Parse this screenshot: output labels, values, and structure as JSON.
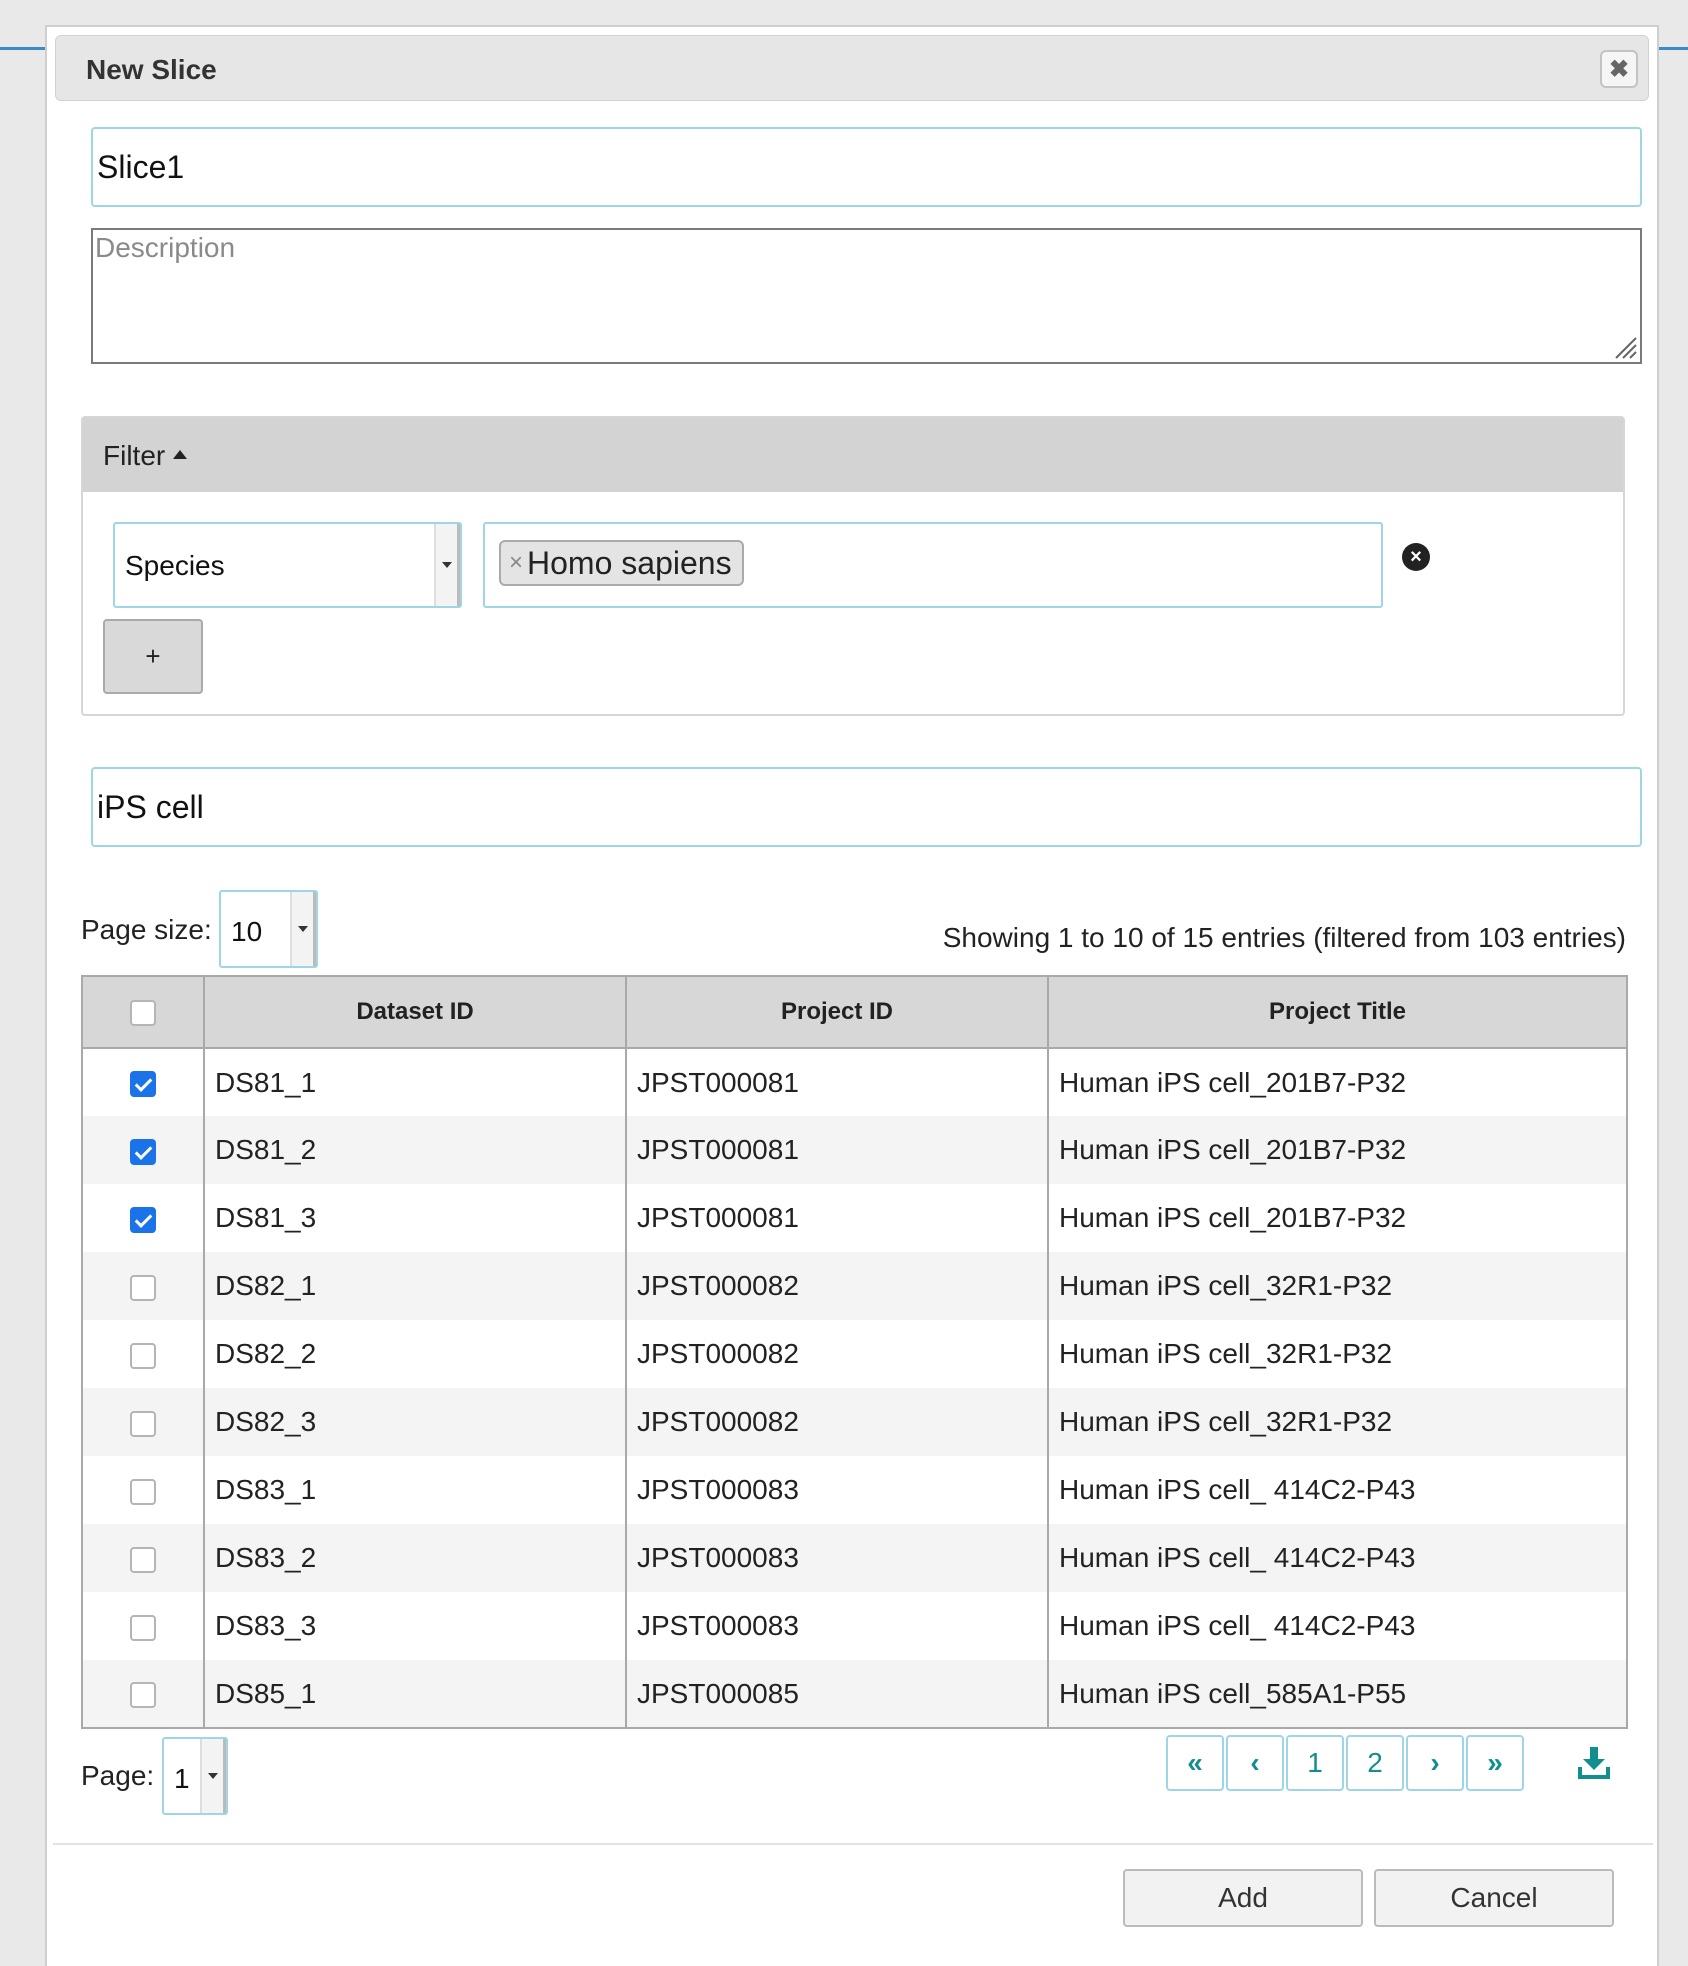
{
  "dialog": {
    "title": "New Slice"
  },
  "form": {
    "name_value": "Slice1",
    "description_placeholder": "Description",
    "search_value": "iPS cell"
  },
  "filter": {
    "header_label": "Filter",
    "field_select_value": "Species",
    "selected_tag": "Homo sapiens",
    "add_button_label": "+"
  },
  "table_controls": {
    "page_size_label": "Page size:",
    "page_size_value": "10",
    "info_text": "Showing 1 to 10 of 15 entries (filtered from 103 entries)",
    "page_label": "Page:",
    "page_value": "1"
  },
  "table": {
    "columns": [
      "Dataset ID",
      "Project ID",
      "Project Title"
    ],
    "rows": [
      {
        "checked": true,
        "dataset_id": "DS81_1",
        "project_id": "JPST000081",
        "project_title": "Human iPS cell_201B7-P32"
      },
      {
        "checked": true,
        "dataset_id": "DS81_2",
        "project_id": "JPST000081",
        "project_title": "Human iPS cell_201B7-P32"
      },
      {
        "checked": true,
        "dataset_id": "DS81_3",
        "project_id": "JPST000081",
        "project_title": "Human iPS cell_201B7-P32"
      },
      {
        "checked": false,
        "dataset_id": "DS82_1",
        "project_id": "JPST000082",
        "project_title": "Human iPS cell_32R1-P32"
      },
      {
        "checked": false,
        "dataset_id": "DS82_2",
        "project_id": "JPST000082",
        "project_title": "Human iPS cell_32R1-P32"
      },
      {
        "checked": false,
        "dataset_id": "DS82_3",
        "project_id": "JPST000082",
        "project_title": "Human iPS cell_32R1-P32"
      },
      {
        "checked": false,
        "dataset_id": "DS83_1",
        "project_id": "JPST000083",
        "project_title": "Human iPS cell_ 414C2-P43"
      },
      {
        "checked": false,
        "dataset_id": "DS83_2",
        "project_id": "JPST000083",
        "project_title": "Human iPS cell_ 414C2-P43"
      },
      {
        "checked": false,
        "dataset_id": "DS83_3",
        "project_id": "JPST000083",
        "project_title": "Human iPS cell_ 414C2-P43"
      },
      {
        "checked": false,
        "dataset_id": "DS85_1",
        "project_id": "JPST000085",
        "project_title": "Human iPS cell_585A1-P55"
      }
    ]
  },
  "pagination": {
    "first": "«",
    "prev": "‹",
    "pages": [
      "1",
      "2"
    ],
    "next": "›",
    "last": "»"
  },
  "footer": {
    "add_label": "Add",
    "cancel_label": "Cancel"
  },
  "colors": {
    "accent_teal": "#128e8e",
    "checkbox_blue": "#1a73e8",
    "input_border": "#9fd6e6"
  },
  "icons": {
    "close": "close-icon",
    "clear_filter": "clear-circle-icon",
    "download": "download-icon",
    "caret": "caret-up-icon"
  }
}
